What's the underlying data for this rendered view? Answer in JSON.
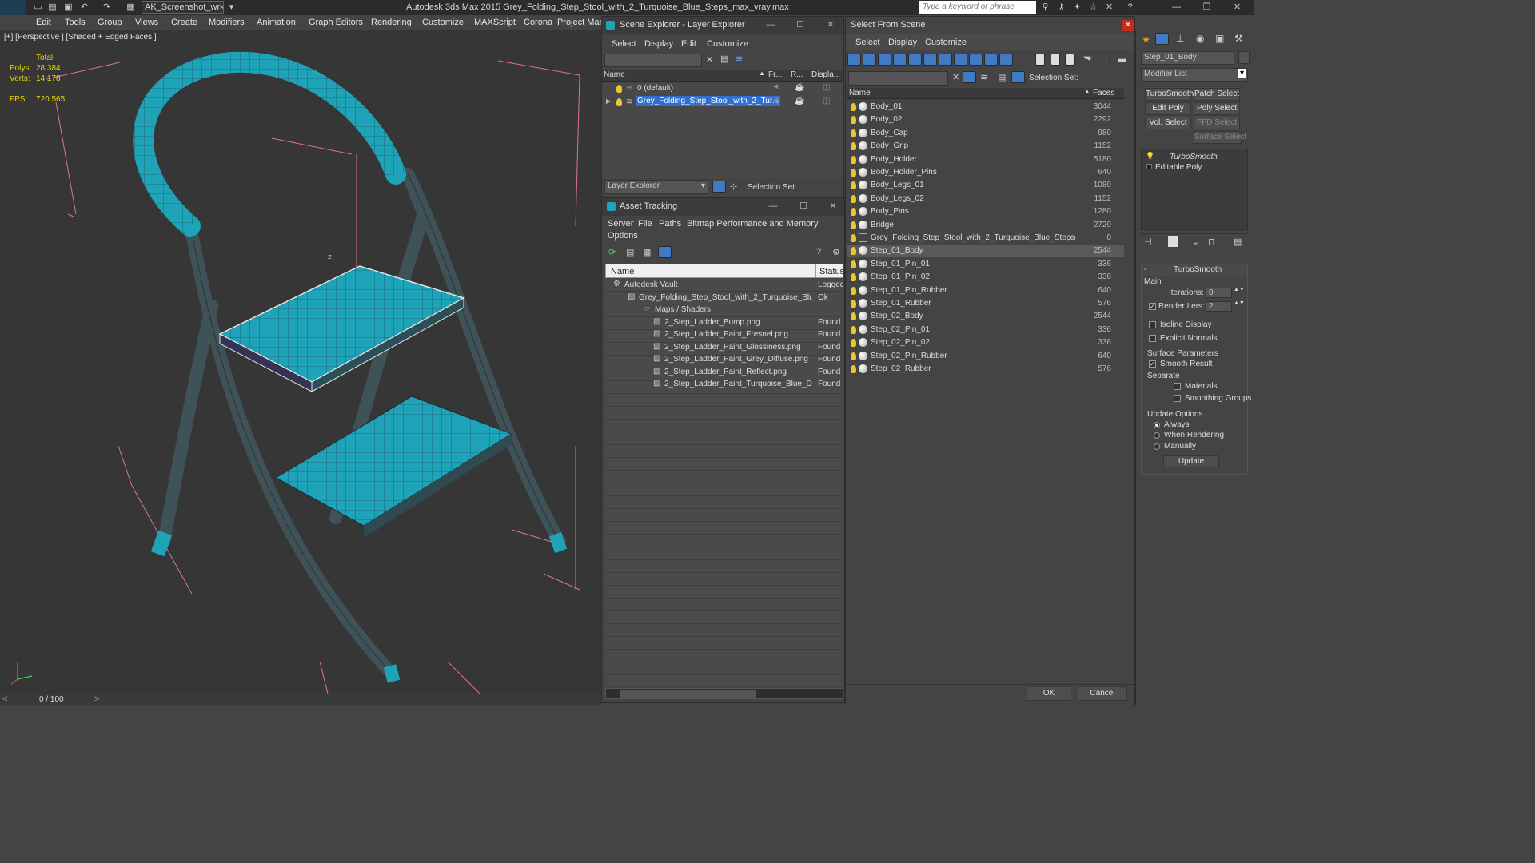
{
  "app": {
    "title": "Autodesk 3ds Max  2015    Grey_Folding_Step_Stool_with_2_Turquoise_Blue_Steps_max_vray.max",
    "logo": "MAX",
    "workspace": "AK_Screenshot_wrksp",
    "search_placeholder": "Type a keyword or phrase"
  },
  "menus": [
    "Edit",
    "Tools",
    "Group",
    "Views",
    "Create",
    "Modifiers",
    "Animation",
    "Graph Editors",
    "Rendering",
    "Customize",
    "MAXScript",
    "Corona",
    "Project Man"
  ],
  "viewport": {
    "label": "[+] [Perspective ] [Shaded + Edged Faces ]",
    "stats": {
      "total_label": "Total",
      "polys_label": "Polys:",
      "polys": "28 384",
      "verts_label": "Verts:",
      "verts": "14 178",
      "fps_label": "FPS:",
      "fps": "720.565"
    },
    "axis_label": "z"
  },
  "timeline": {
    "frame": "0 / 100"
  },
  "scene_explorer": {
    "title": "Scene Explorer - Layer Explorer",
    "menu": [
      "Select",
      "Display",
      "Edit",
      "Customize"
    ],
    "columns": [
      "Name",
      "Fr...",
      "R...",
      "Displa..."
    ],
    "rows": [
      {
        "name": "0 (default)",
        "selected": false
      },
      {
        "name": "Grey_Folding_Step_Stool_with_2_Tur...",
        "selected": true
      }
    ],
    "footer_dropdown": "Layer Explorer",
    "selection_set_label": "Selection Set:"
  },
  "asset_tracking": {
    "title": "Asset Tracking",
    "menu": [
      "Server",
      "File",
      "Paths",
      "Bitmap Performance and Memory",
      "Options"
    ],
    "columns": [
      "Name",
      "Status"
    ],
    "rows": [
      {
        "name": "Autodesk Vault",
        "status": "Logged"
      },
      {
        "name": "Grey_Folding_Step_Stool_with_2_Turquoise_Blu...",
        "status": "Ok"
      },
      {
        "name": "Maps / Shaders",
        "status": ""
      },
      {
        "name": "2_Step_Ladder_Bump.png",
        "status": "Found"
      },
      {
        "name": "2_Step_Ladder_Paint_Fresnel.png",
        "status": "Found"
      },
      {
        "name": "2_Step_Ladder_Paint_Glossiness.png",
        "status": "Found"
      },
      {
        "name": "2_Step_Ladder_Paint_Grey_Diffuse.png",
        "status": "Found"
      },
      {
        "name": "2_Step_Ladder_Paint_Reflect.png",
        "status": "Found"
      },
      {
        "name": "2_Step_Ladder_Paint_Turquoise_Blue_Diff...",
        "status": "Found"
      }
    ]
  },
  "select_from_scene": {
    "title": "Select From Scene",
    "menu": [
      "Select",
      "Display",
      "Customize"
    ],
    "selection_set_label": "Selection Set:",
    "columns": [
      "Name",
      "Faces"
    ],
    "rows": [
      {
        "name": "Body_01",
        "faces": "3044"
      },
      {
        "name": "Body_02",
        "faces": "2292"
      },
      {
        "name": "Body_Cap",
        "faces": "980"
      },
      {
        "name": "Body_Grip",
        "faces": "1152"
      },
      {
        "name": "Body_Holder",
        "faces": "5180"
      },
      {
        "name": "Body_Holder_Pins",
        "faces": "640"
      },
      {
        "name": "Body_Legs_01",
        "faces": "1080"
      },
      {
        "name": "Body_Legs_02",
        "faces": "1152"
      },
      {
        "name": "Body_Pins",
        "faces": "1280"
      },
      {
        "name": "Bridge",
        "faces": "2720"
      },
      {
        "name": "Grey_Folding_Step_Stool_with_2_Turquoise_Blue_Steps",
        "faces": "0"
      },
      {
        "name": "Step_01_Body",
        "faces": "2544"
      },
      {
        "name": "Step_01_Pin_01",
        "faces": "336"
      },
      {
        "name": "Step_01_Pin_02",
        "faces": "336"
      },
      {
        "name": "Step_01_Pin_Rubber",
        "faces": "640"
      },
      {
        "name": "Step_01_Rubber",
        "faces": "576"
      },
      {
        "name": "Step_02_Body",
        "faces": "2544"
      },
      {
        "name": "Step_02_Pin_01",
        "faces": "336"
      },
      {
        "name": "Step_02_Pin_02",
        "faces": "336"
      },
      {
        "name": "Step_02_Pin_Rubber",
        "faces": "640"
      },
      {
        "name": "Step_02_Rubber",
        "faces": "576"
      }
    ],
    "selected_row": "Step_01_Body",
    "ok_label": "OK",
    "cancel_label": "Cancel"
  },
  "command_panel": {
    "object_name": "Step_01_Body",
    "modifier_list": "Modifier List",
    "mod_buttons": [
      "TurboSmooth",
      "Patch Select",
      "Edit Poly",
      "Poly Select",
      "Vol. Select",
      "FFD Select",
      "Surface Select"
    ],
    "stack": [
      "TurboSmooth",
      "Editable Poly"
    ],
    "rollout_title": "TurboSmooth",
    "main_label": "Main",
    "iterations_label": "Iterations:",
    "iterations": "0",
    "render_iters_label": "Render Iters:",
    "render_iters": "2",
    "isoline_label": "Isoline Display",
    "explicit_normals_label": "Explicit Normals",
    "surface_params_label": "Surface Parameters",
    "smooth_result_label": "Smooth Result",
    "separate_label": "Separate",
    "materials_label": "Materials",
    "smoothing_groups_label": "Smoothing Groups",
    "update_options_label": "Update Options",
    "always_label": "Always",
    "when_rendering_label": "When Rendering",
    "manually_label": "Manually",
    "update_button": "Update"
  },
  "colors": {
    "turquoise": "#1fa3b8",
    "frame": "#3f5257",
    "bbox": "#ff7aa8",
    "selection": "#5a5a5a",
    "accent": "#e8d800"
  }
}
